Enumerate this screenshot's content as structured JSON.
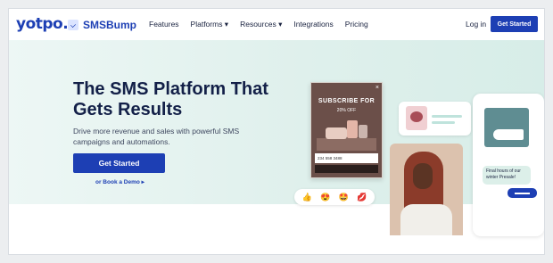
{
  "nav": {
    "logo": "yotpo.",
    "product": "SMSBump",
    "items": [
      "Features",
      "Platforms ▾",
      "Resources ▾",
      "Integrations",
      "Pricing"
    ],
    "login": "Log in",
    "cta": "Get Started"
  },
  "hero": {
    "headline": "The SMS Platform That Gets Results",
    "subtext": "Drive more revenue and sales with powerful SMS campaigns and automations.",
    "cta": "Get Started",
    "demo_link": "or Book a Demo ▸"
  },
  "popup": {
    "title": "SUBSCRIBE FOR",
    "offer": "20% OFF",
    "phone_value": "234 558 3488",
    "close": "×"
  },
  "reactions": [
    "👍",
    "😍",
    "🤩",
    "💋"
  ],
  "phone_card": {
    "message": "Final hours of our winter Presale!"
  },
  "colors": {
    "brand": "#1d3fb4",
    "hero_bg": "#dff0ec"
  }
}
